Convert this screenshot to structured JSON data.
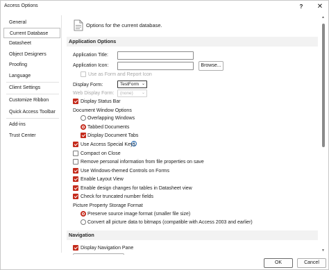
{
  "window": {
    "title": "Access Options",
    "help_label": "?",
    "close_label": "✕"
  },
  "nav": {
    "items": [
      {
        "label": "General",
        "selected": false
      },
      {
        "label": "Current Database",
        "selected": true
      },
      {
        "label": "Datasheet",
        "selected": false
      },
      {
        "label": "Object Designers",
        "selected": false
      },
      {
        "label": "Proofing",
        "selected": false
      },
      {
        "label": "Language",
        "selected": false
      },
      {
        "label": "Client Settings",
        "selected": false
      },
      {
        "label": "Customize Ribbon",
        "selected": false
      },
      {
        "label": "Quick Access Toolbar",
        "selected": false
      },
      {
        "label": "Add-ins",
        "selected": false
      },
      {
        "label": "Trust Center",
        "selected": false
      }
    ]
  },
  "header": {
    "text": "Options for the current database.",
    "icon": "page-icon"
  },
  "app_options": {
    "heading": "Application Options",
    "app_title_label": "Application Title:",
    "app_title_value": "",
    "app_icon_label": "Application Icon:",
    "app_icon_value": "",
    "browse_label": "Browse...",
    "use_as_icon_label": "Use as Form and Report Icon",
    "display_form_label": "Display Form:",
    "display_form_value": "TestForm",
    "web_display_form_label": "Web Display Form:",
    "web_display_form_value": "(none)",
    "display_status_bar_label": "Display Status Bar",
    "doc_window_options_label": "Document Window Options",
    "overlapping_windows_label": "Overlapping Windows",
    "tabbed_documents_label": "Tabbed Documents",
    "display_doc_tabs_label": "Display Document Tabs",
    "special_keys_label": "Use Access Special Keys",
    "compact_on_close_label": "Compact on Close",
    "remove_personal_label": "Remove personal information from file properties on save",
    "win_themed_label": "Use Windows-themed Controls on Forms",
    "layout_view_label": "Enable Layout View",
    "design_changes_label": "Enable design changes for tables in Datasheet view",
    "truncated_label": "Check for truncated number fields",
    "picture_storage_label": "Picture Property Storage Format",
    "preserve_source_label": "Preserve source image format (smaller file size)",
    "convert_bitmaps_label": "Convert all picture data to bitmaps (compatible with Access 2003 and earlier)"
  },
  "navigation": {
    "heading": "Navigation",
    "display_nav_pane_label": "Display Navigation Pane"
  },
  "footer": {
    "ok_label": "OK",
    "cancel_label": "Cancel"
  },
  "colors": {
    "accent": "#c42b1c"
  }
}
